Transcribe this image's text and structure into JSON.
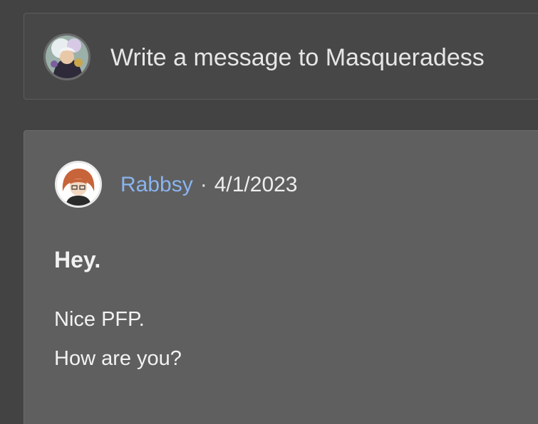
{
  "compose": {
    "placeholder": "Write a message to Masqueradess",
    "avatar_icon": "user-avatar-icon"
  },
  "message": {
    "author": "Rabbsy",
    "separator": "·",
    "date": "4/1/2023",
    "avatar_icon": "author-avatar-icon",
    "lines": [
      "Hey.",
      "Nice PFP.",
      "How are you?"
    ]
  },
  "colors": {
    "background": "#434343",
    "compose_background": "#474747",
    "card_background": "#5f5f5f",
    "author_link": "#8ab4f0",
    "text": "#f2f2f2"
  }
}
